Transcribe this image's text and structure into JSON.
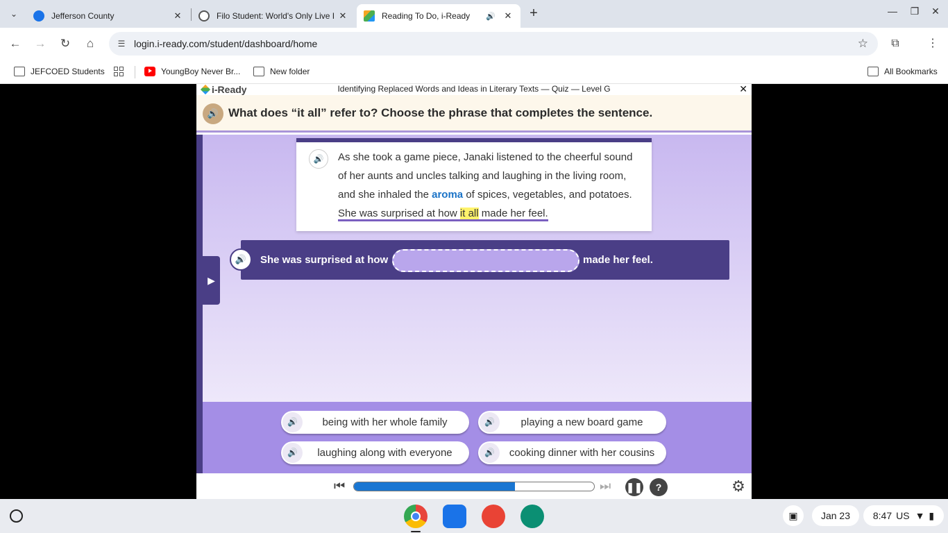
{
  "browser": {
    "tabs": [
      {
        "title": "Jefferson County",
        "close": "✕"
      },
      {
        "title": "Filo Student: World's Only Live I",
        "close": "✕"
      },
      {
        "title": "Reading To Do, i-Ready",
        "close": "✕",
        "audio": "🔊"
      }
    ],
    "new_tab": "+",
    "url": "login.i-ready.com/student/dashboard/home",
    "bookmarks": [
      {
        "label": "JEFCOED Students",
        "icon": "folder-icon"
      },
      {
        "label": "",
        "icon": "apps-grid-icon"
      },
      {
        "label": "YoungBoy Never Br...",
        "icon": "youtube-icon"
      },
      {
        "label": "New folder",
        "icon": "folder-icon"
      }
    ],
    "all_bookmarks": "All Bookmarks"
  },
  "app": {
    "logo": "i-Ready",
    "lesson_title": "Identifying Replaced Words and Ideas in Literary Texts — Quiz — Level G",
    "close": "✕",
    "question": "What does “it all” refer to? Choose the phrase that completes the sentence.",
    "passage": {
      "part1": "As she took a game piece, Janaki listened to the cheerful sound of her aunts and uncles talking and laughing in the living room, and she inhaled the ",
      "aroma": "aroma",
      "part2": " of spices, vegetables, and potatoes. ",
      "underlined_before": "She was surprised at how ",
      "highlight": "it all",
      "underlined_after": " made her feel."
    },
    "sentence": {
      "before": "She was surprised at how",
      "after": "made her feel."
    },
    "answers": [
      "being with her whole family",
      "playing a new board game",
      "laughing along with everyone",
      "cooking dinner with her cousins"
    ],
    "progress_fraction": 0.67,
    "help_label": "?"
  },
  "shelf": {
    "date": "Jan 23",
    "time": "8:47",
    "locale": "US"
  },
  "colors": {
    "accent_purple": "#4a3e86",
    "answer_panel": "#a48ee6",
    "progress_blue": "#1a76d2",
    "aroma_link": "#1a73c7",
    "highlight": "#fff36b"
  }
}
